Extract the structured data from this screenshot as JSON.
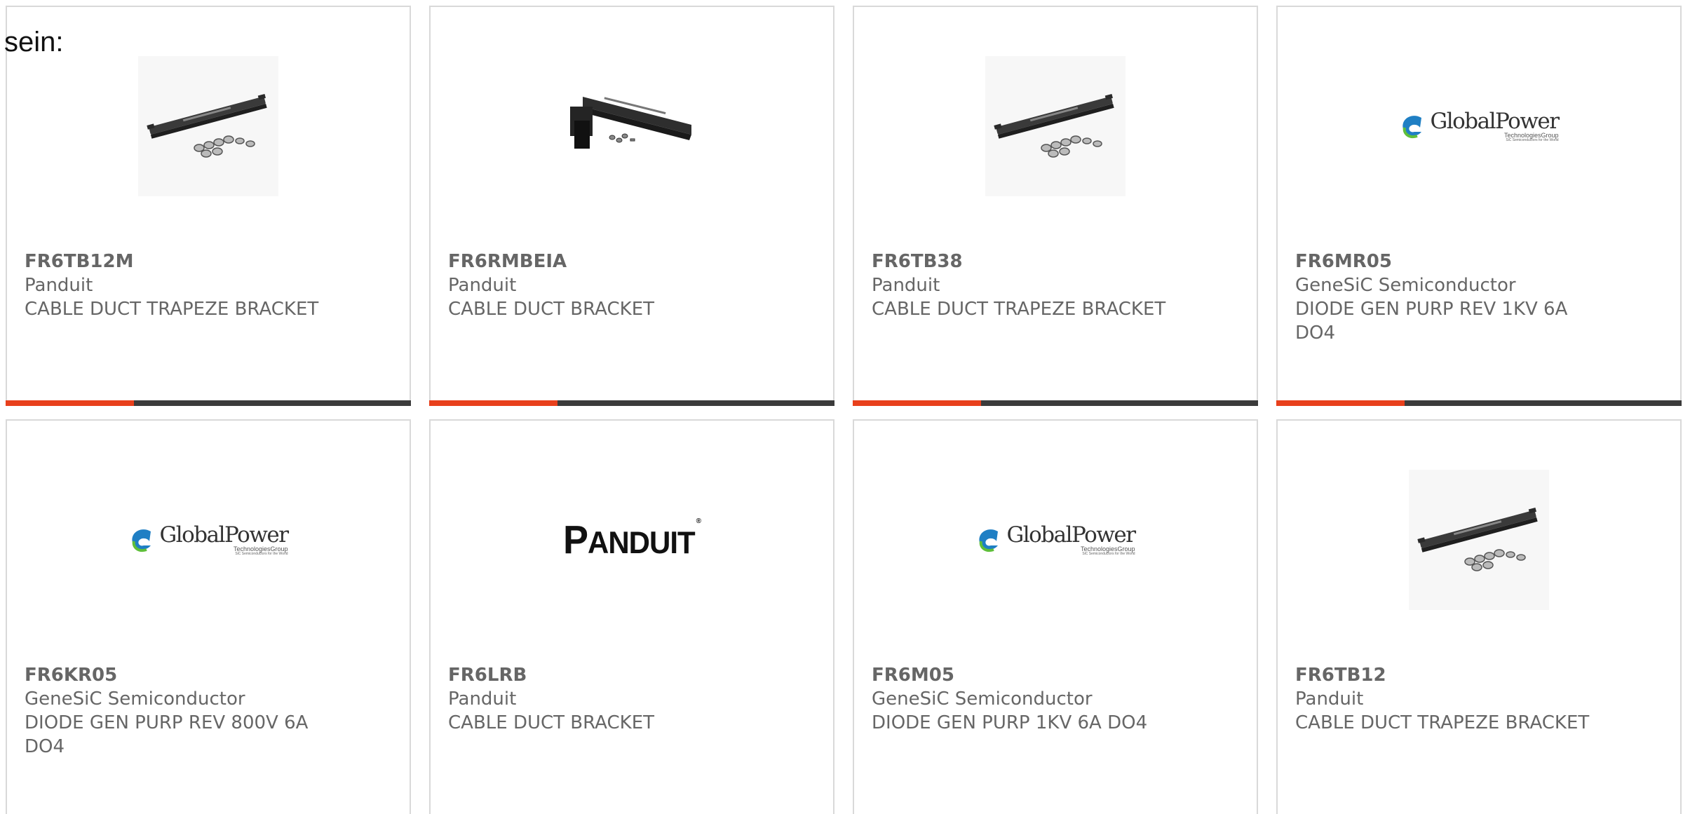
{
  "intro_text": "sein:",
  "brand": {
    "accent_color": "#e8401c",
    "bar_color": "#3b3b3b",
    "globalpower_name": "GlobalPower",
    "globalpower_line1": "TechnologiesGroup",
    "globalpower_line2": "SiC Semiconductors for the World",
    "panduit_big_first": "P",
    "panduit_rest": "ANDUIT",
    "panduit_reg": "®"
  },
  "cards": [
    {
      "part": "FR6TB12M",
      "maker": "Panduit",
      "desc": "CABLE DUCT TRAPEZE BRACKET",
      "image": "trapeze-bracket-photo"
    },
    {
      "part": "FR6RMBEIA",
      "maker": "Panduit",
      "desc": "CABLE DUCT BRACKET",
      "image": "cable-duct-bracket-photo"
    },
    {
      "part": "FR6TB38",
      "maker": "Panduit",
      "desc": "CABLE DUCT TRAPEZE BRACKET",
      "image": "trapeze-bracket-photo"
    },
    {
      "part": "FR6MR05",
      "maker": "GeneSiC Semiconductor",
      "desc": "DIODE GEN PURP REV 1KV 6A DO4",
      "image": "globalpower-logo"
    },
    {
      "part": "FR6KR05",
      "maker": "GeneSiC Semiconductor",
      "desc": "DIODE GEN PURP REV 800V 6A DO4",
      "image": "globalpower-logo"
    },
    {
      "part": "FR6LRB",
      "maker": "Panduit",
      "desc": "CABLE DUCT BRACKET",
      "image": "panduit-logo"
    },
    {
      "part": "FR6M05",
      "maker": "GeneSiC Semiconductor",
      "desc": "DIODE GEN PURP 1KV 6A DO4",
      "image": "globalpower-logo"
    },
    {
      "part": "FR6TB12",
      "maker": "Panduit",
      "desc": "CABLE DUCT TRAPEZE BRACKET",
      "image": "trapeze-bracket-photo"
    }
  ]
}
